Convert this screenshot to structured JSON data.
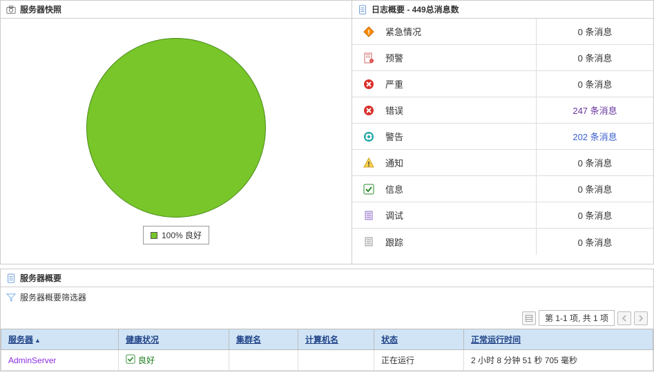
{
  "snapshot": {
    "title": "服务器快照",
    "legend_text": "100% 良好"
  },
  "chart_data": {
    "type": "pie",
    "title": "服务器快照",
    "categories": [
      "良好"
    ],
    "values": [
      100
    ],
    "colors": [
      "#78C62A"
    ]
  },
  "log_summary": {
    "title": "日志概要 - 449总消息数",
    "rows": [
      {
        "icon": "emergency",
        "label": "紧急情况",
        "count_text": "0 条消息",
        "link": false
      },
      {
        "icon": "alert",
        "label": "预警",
        "count_text": "0 条消息",
        "link": false
      },
      {
        "icon": "critical",
        "label": "严重",
        "count_text": "0 条消息",
        "link": false
      },
      {
        "icon": "error",
        "label": "错误",
        "count_text": "247 条消息",
        "link": true,
        "purple": true
      },
      {
        "icon": "warning",
        "label": "警告",
        "count_text": "202 条消息",
        "link": true,
        "blue": true
      },
      {
        "icon": "notice",
        "label": "通知",
        "count_text": "0 条消息",
        "link": false
      },
      {
        "icon": "info",
        "label": "信息",
        "count_text": "0 条消息",
        "link": false
      },
      {
        "icon": "debug",
        "label": "调试",
        "count_text": "0 条消息",
        "link": false
      },
      {
        "icon": "trace",
        "label": "跟踪",
        "count_text": "0 条消息",
        "link": false
      }
    ]
  },
  "server_overview": {
    "title": "服务器概要",
    "filter_label": "服务器概要筛选器",
    "pager_text": "第 1-1 项, 共 1 项",
    "columns": {
      "server": "服务器",
      "health": "健康状况",
      "cluster": "集群名",
      "machine": "计算机名",
      "status": "状态",
      "uptime": "正常运行时间"
    },
    "row": {
      "server": "AdminServer",
      "health": "良好",
      "cluster": "",
      "machine": "",
      "status": "正在运行",
      "uptime": "2 小时 8 分钟 51 秒 705 毫秒"
    }
  }
}
